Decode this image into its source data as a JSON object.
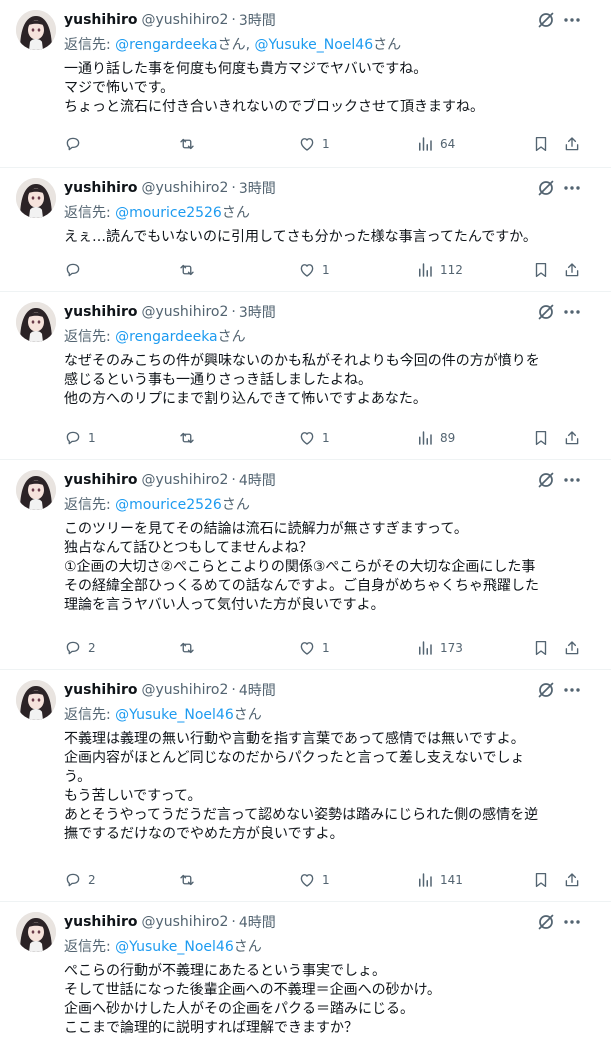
{
  "reply_prefix": "返信先: ",
  "posts": [
    {
      "name": "yushihiro",
      "handle": "@yushihiro2",
      "time": "3時間",
      "reply_to": [
        {
          "m": "@rengardeeka",
          "s": "さん, "
        },
        {
          "m": "@Yusuke_Noel46",
          "s": "さん"
        }
      ],
      "lines": [
        "一通り話した事を何度も何度も貴方マジでヤバいですね。",
        "マジで怖いです。",
        "ちょっと流石に付き合いきれないのでブロックさせて頂きますね。"
      ],
      "replies": "",
      "retweets": "",
      "likes": "1",
      "views": "64"
    },
    {
      "name": "yushihiro",
      "handle": "@yushihiro2",
      "time": "3時間",
      "reply_to": [
        {
          "m": "@mourice2526",
          "s": "さん"
        }
      ],
      "lines": [
        "えぇ…読んでもいないのに引用してさも分かった様な事言ってたんですか。"
      ],
      "replies": "",
      "retweets": "",
      "likes": "1",
      "views": "112"
    },
    {
      "name": "yushihiro",
      "handle": "@yushihiro2",
      "time": "3時間",
      "reply_to": [
        {
          "m": "@rengardeeka",
          "s": "さん"
        }
      ],
      "lines": [
        "なぜそのみこちの件が興味ないのかも私がそれよりも今回の件の方が憤りを",
        "感じるという事も一通りさっき話しましたよね。",
        "他の方へのリプにまで割り込んできて怖いですよあなた。"
      ],
      "replies": "1",
      "retweets": "",
      "likes": "1",
      "views": "89"
    },
    {
      "name": "yushihiro",
      "handle": "@yushihiro2",
      "time": "4時間",
      "reply_to": [
        {
          "m": "@mourice2526",
          "s": "さん"
        }
      ],
      "lines": [
        "このツリーを見てその結論は流石に読解力が無さすぎますって。",
        "独占なんて話ひとつもしてませんよね？",
        "①企画の大切さ②ぺこらとこよりの関係③ぺこらがその大切な企画にした事",
        "その経緯全部ひっくるめての話なんですよ。ご自身がめちゃくちゃ飛躍した",
        "理論を言うヤバい人って気付いた方が良いですよ。"
      ],
      "replies": "2",
      "retweets": "",
      "likes": "1",
      "views": "173"
    },
    {
      "name": "yushihiro",
      "handle": "@yushihiro2",
      "time": "4時間",
      "reply_to": [
        {
          "m": "@Yusuke_Noel46",
          "s": "さん"
        }
      ],
      "lines": [
        "不義理は義理の無い行動や言動を指す言葉であって感情では無いですよ。",
        "企画内容がほとんど同じなのだからパクったと言って差し支えないでしょ",
        "う。",
        "もう苦しいですって。",
        "あとそうやってうだうだ言って認めない姿勢は踏みにじられた側の感情を逆",
        "撫でするだけなのでやめた方が良いですよ。"
      ],
      "replies": "2",
      "retweets": "",
      "likes": "1",
      "views": "141"
    },
    {
      "name": "yushihiro",
      "handle": "@yushihiro2",
      "time": "4時間",
      "reply_to": [
        {
          "m": "@Yusuke_Noel46",
          "s": "さん"
        }
      ],
      "lines": [
        "ぺこらの行動が不義理にあたるという事実でしょ。",
        "そして世話になった後輩企画への不義理＝企画への砂かけ。",
        "企画へ砂かけした人がその企画をパクる＝踏みにじる。",
        "ここまで論理的に説明すれば理解できますか？"
      ],
      "replies": "",
      "retweets": "",
      "likes": "",
      "views": ""
    }
  ]
}
